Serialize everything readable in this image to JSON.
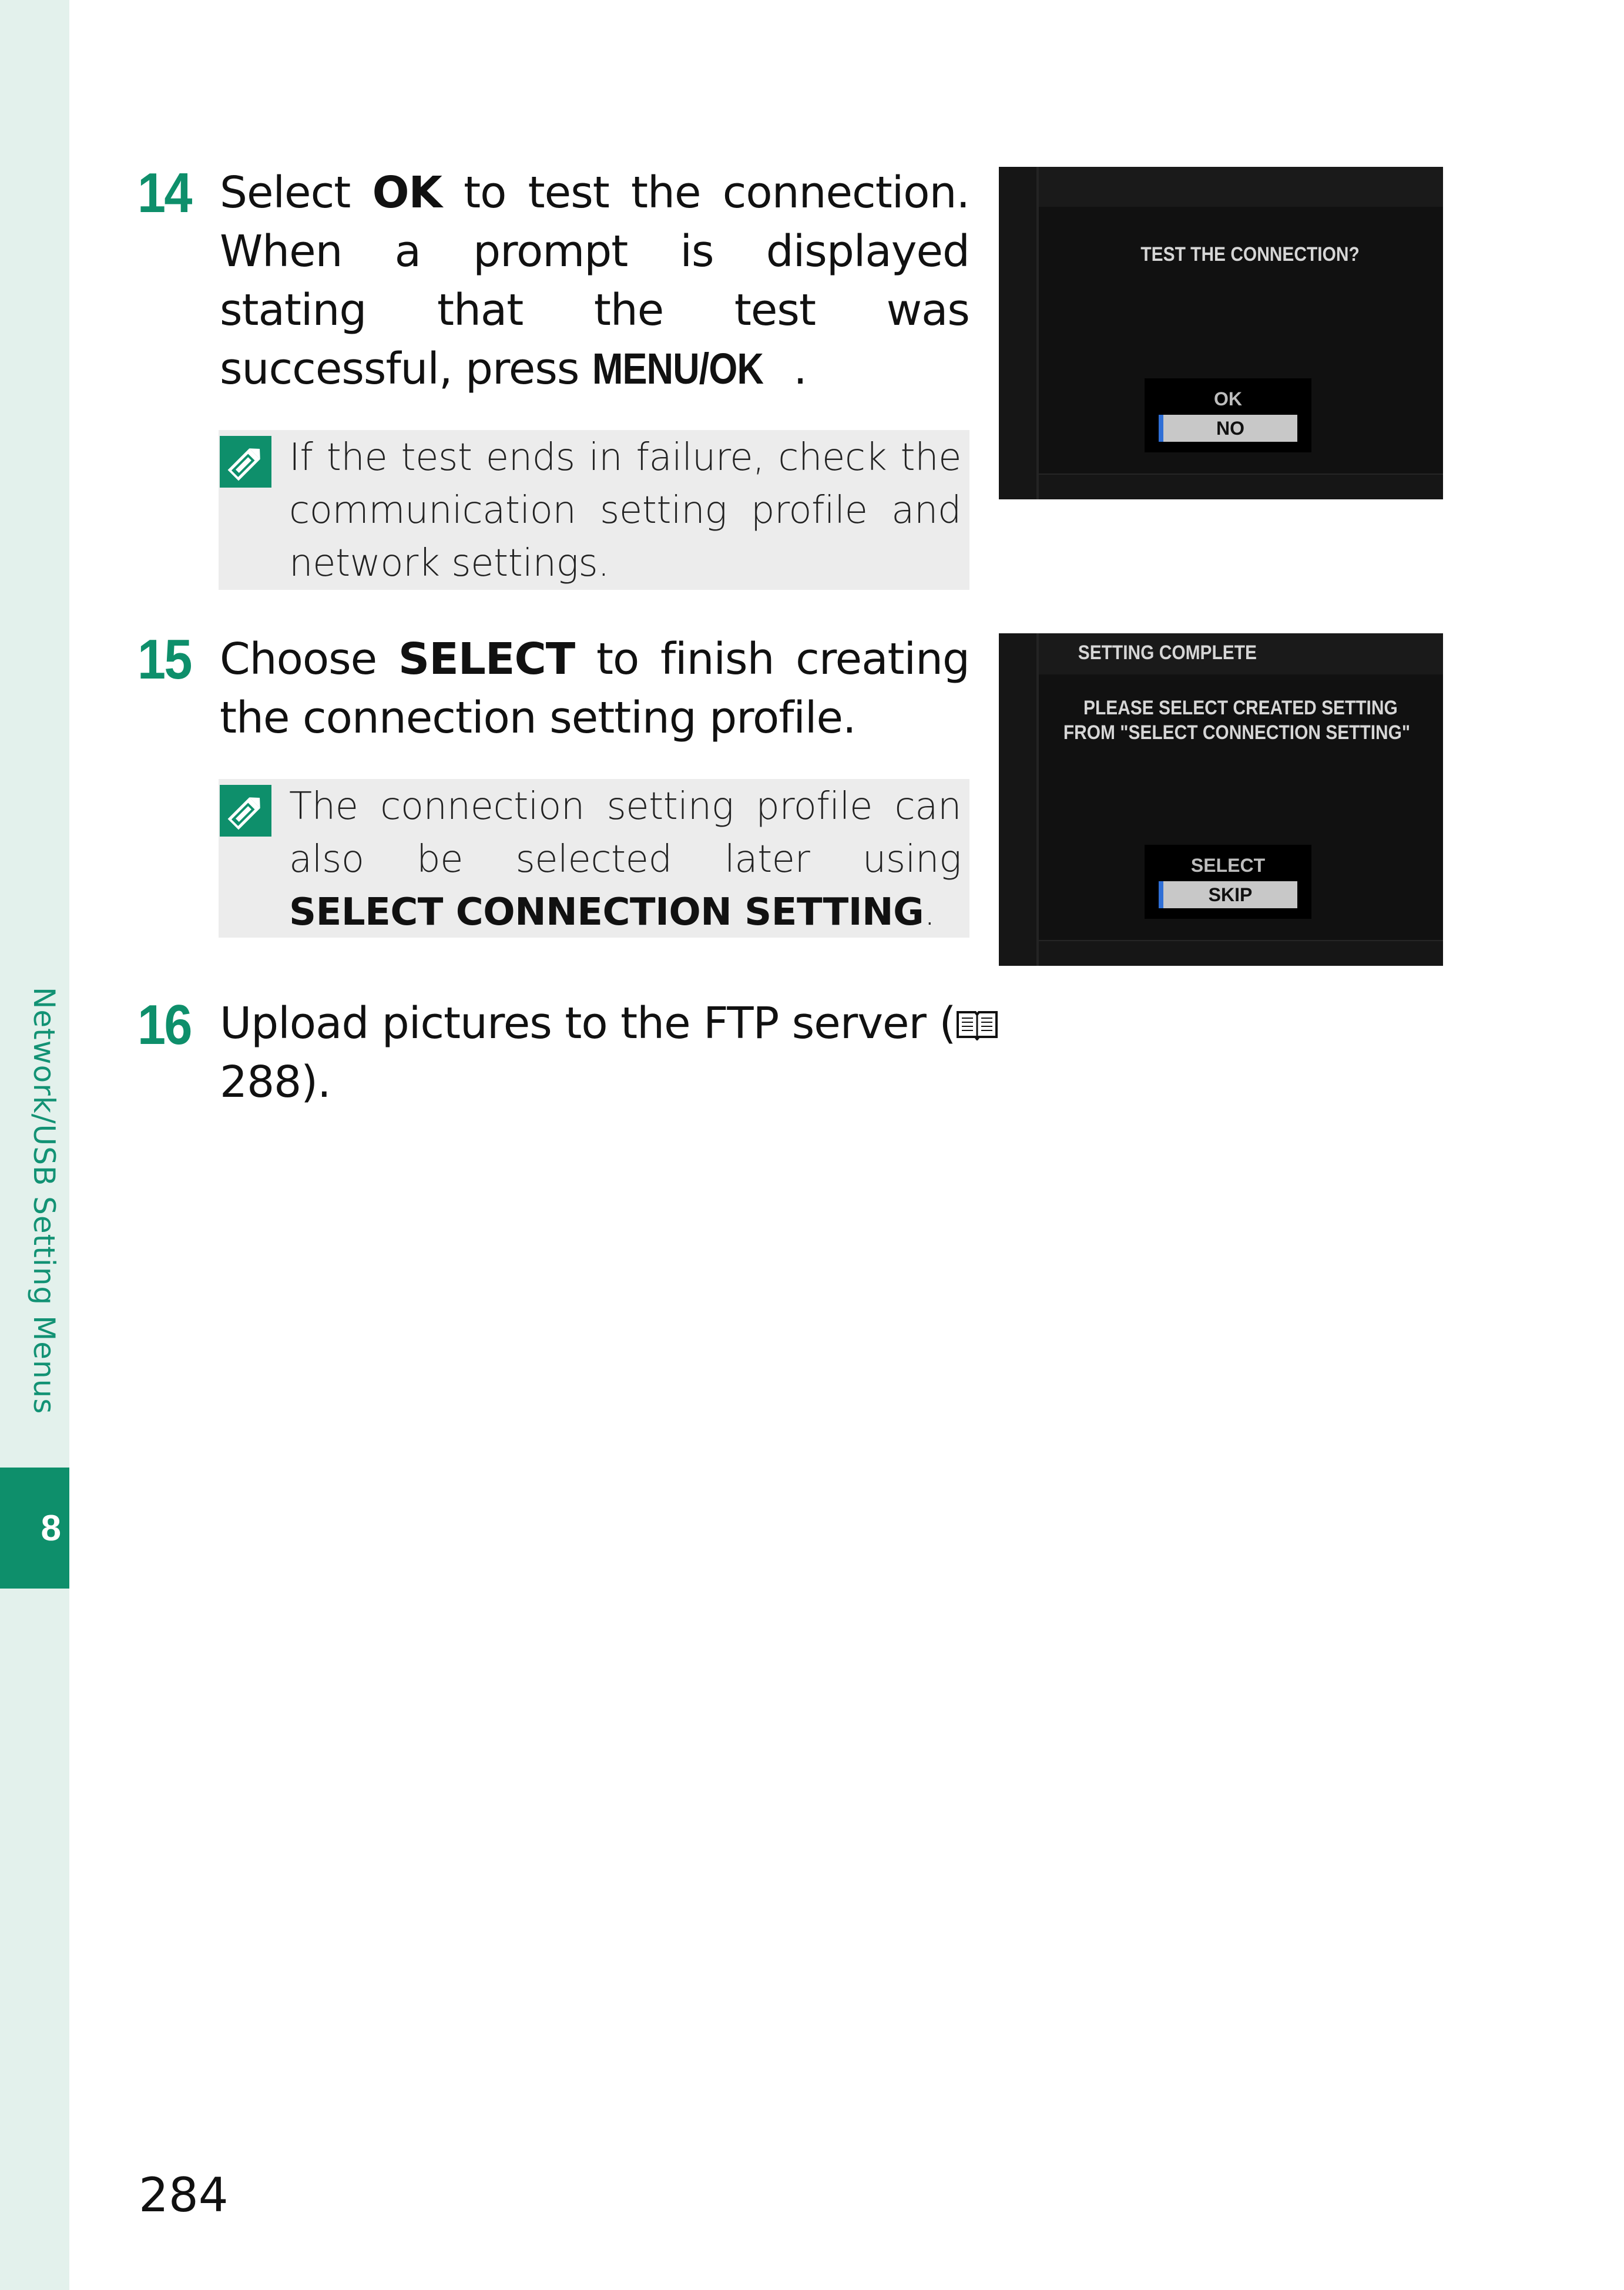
{
  "sidebar": {
    "section_label": "Network/USB Setting Menus",
    "chapter_number": "8"
  },
  "steps": [
    {
      "number": "14",
      "text_pre": "Select ",
      "text_bold": "OK",
      "text_post": " to test the connection. When a prompt is displayed stating that the test was successful, press ",
      "text_key": "MENU/OK",
      "text_end": ".",
      "note": "If the test ends in failure, check the communication setting profile and network settings.",
      "screen": {
        "prompt": "TEST THE CONNECTION?",
        "options": [
          "OK",
          "NO"
        ],
        "selected": "NO"
      }
    },
    {
      "number": "15",
      "text_pre": "Choose ",
      "text_bold": "SELECT",
      "text_post": " to finish creating the connection setting profile.",
      "note_pre": "The connection setting profile can also be selected later using ",
      "note_bold": "SELECT CONNECTION SETTING",
      "note_end": ".",
      "screen": {
        "title": "SETTING COMPLETE",
        "message_line1": "PLEASE SELECT CREATED SETTING",
        "message_line2": "FROM \"SELECT CONNECTION SETTING\"",
        "options": [
          "SELECT",
          "SKIP"
        ],
        "selected": "SKIP"
      }
    },
    {
      "number": "16",
      "text_pre": "Upload pictures to the FTP server (",
      "page_ref": "288",
      "text_end": ")."
    }
  ],
  "page_number": "284",
  "colors": {
    "accent": "#0e8f6b",
    "side_strip": "#e3f1ec",
    "note_bg": "#ececec",
    "selection_bar": "#2f6fd6"
  }
}
